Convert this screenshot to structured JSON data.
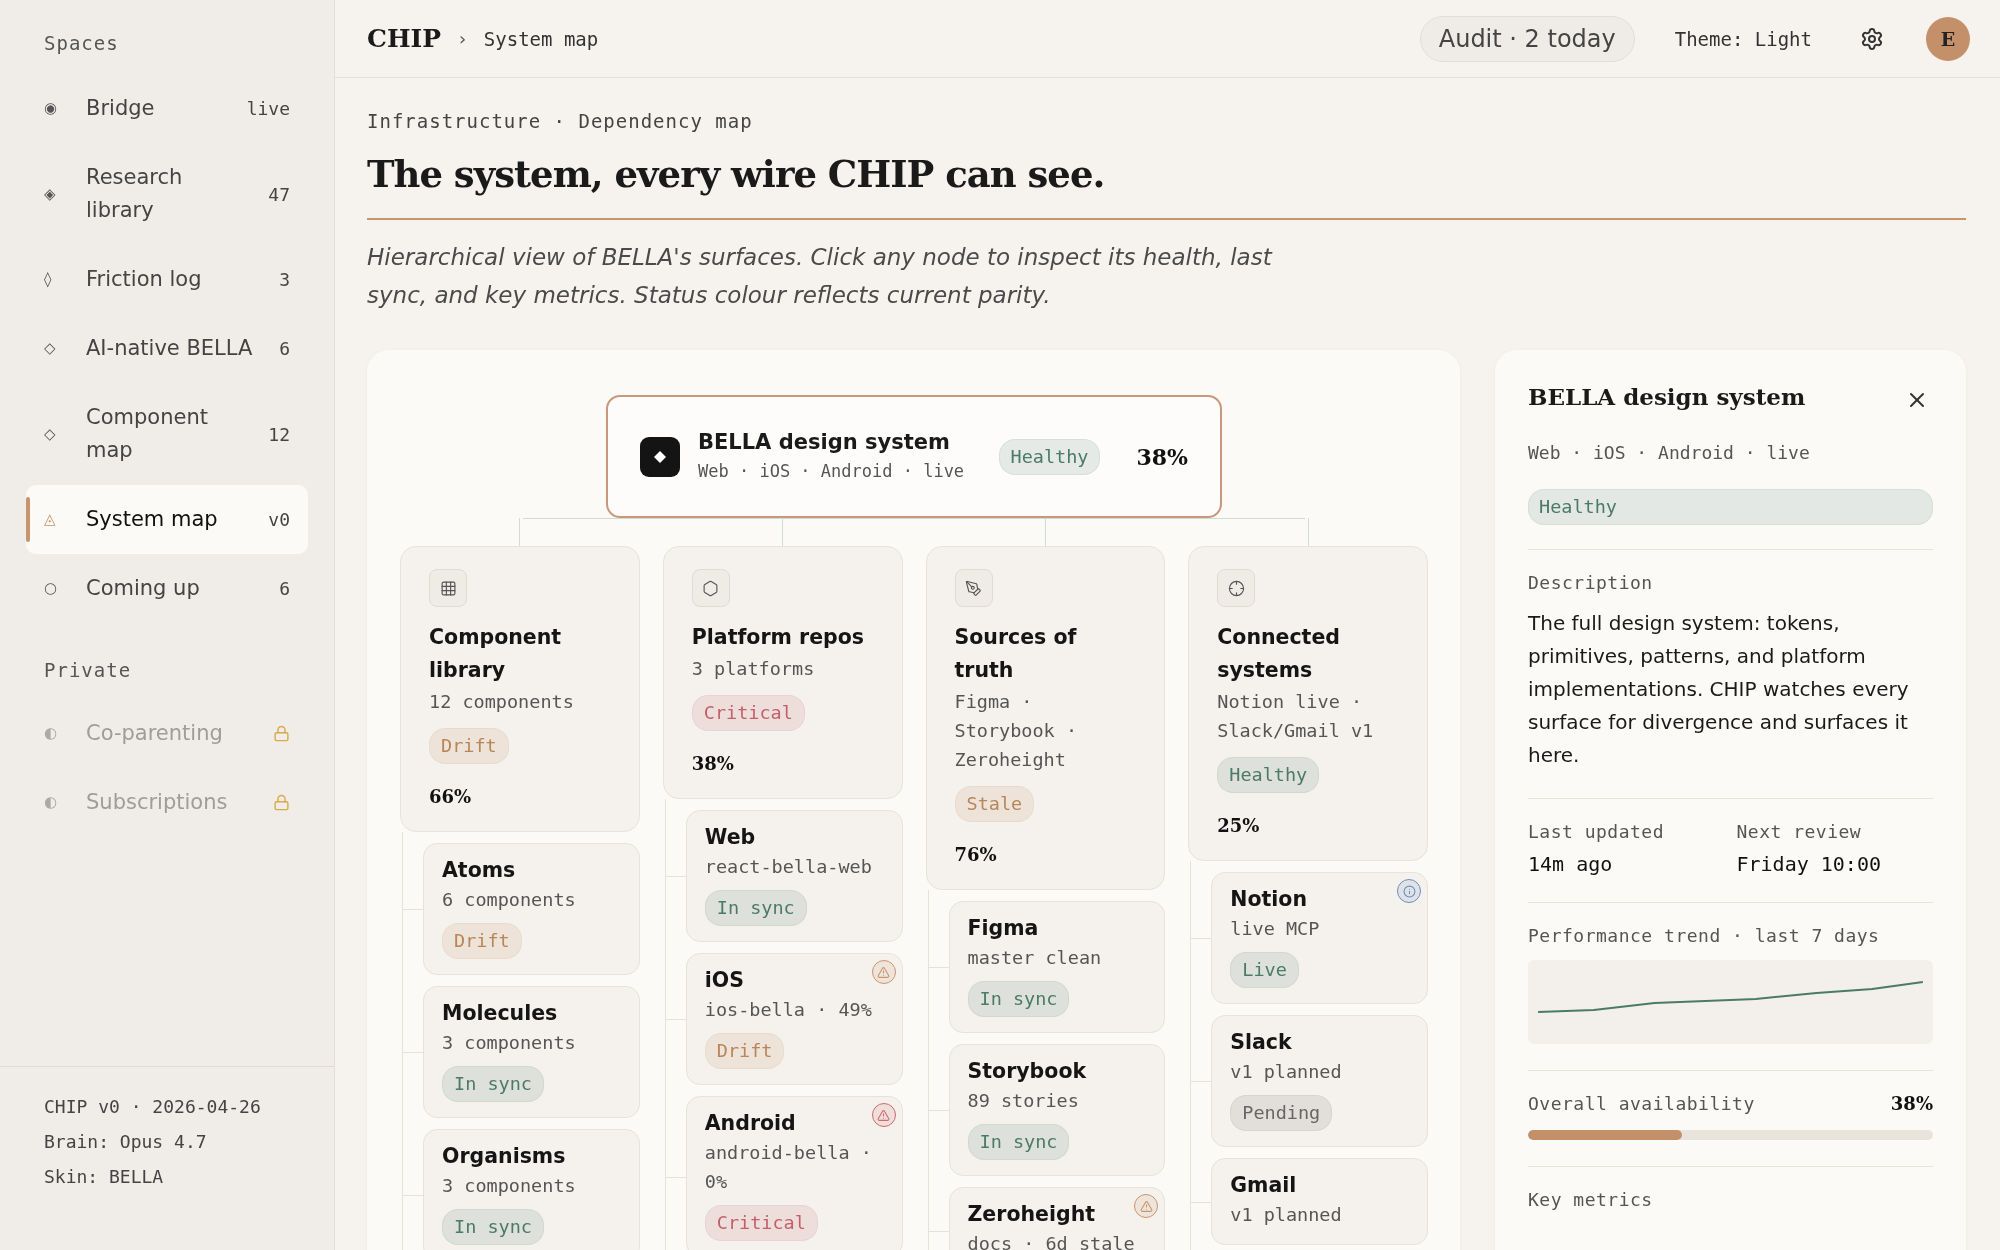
{
  "sidebar": {
    "sections": [
      {
        "heading": "Spaces",
        "items": [
          {
            "icon": "◉",
            "label": "Bridge",
            "count": "live",
            "selected": false,
            "locked": false
          },
          {
            "icon": "◈",
            "label": "Research library",
            "count": "47",
            "selected": false,
            "locked": false
          },
          {
            "icon": "◊",
            "label": "Friction log",
            "count": "3",
            "selected": false,
            "locked": false
          },
          {
            "icon": "◇",
            "label": "AI-native BELLA",
            "count": "6",
            "selected": false,
            "locked": false
          },
          {
            "icon": "◇",
            "label": "Component map",
            "count": "12",
            "selected": false,
            "locked": false
          },
          {
            "icon": "◬",
            "label": "System map",
            "count": "v0",
            "selected": true,
            "locked": false
          },
          {
            "icon": "○",
            "label": "Coming up",
            "count": "6",
            "selected": false,
            "locked": false
          }
        ]
      },
      {
        "heading": "Private",
        "items": [
          {
            "icon": "◐",
            "label": "Co-parenting",
            "selected": false,
            "locked": true
          },
          {
            "icon": "◐",
            "label": "Subscriptions",
            "selected": false,
            "locked": true
          }
        ]
      }
    ],
    "footer": [
      "CHIP v0 · 2026-04-26",
      "Brain: Opus 4.7",
      "Skin: BELLA"
    ]
  },
  "topbar": {
    "brand": "CHIP",
    "separator": "›",
    "crumb": "System map",
    "audit": "Audit · 2 today",
    "theme": "Theme: Light",
    "avatar": "E"
  },
  "header": {
    "eyebrow": "Infrastructure · Dependency map",
    "title": "The system, every wire CHIP can see.",
    "intro": "Hierarchical view of BELLA's surfaces. Click any node to inspect its health, last sync, and key metrics. Status colour reflects current parity."
  },
  "map": {
    "root": {
      "title": "BELLA design system",
      "meta": "Web · iOS · Android · live",
      "status": {
        "label": "Healthy",
        "color": "#4b7a68"
      },
      "percent": "38%",
      "selected": true
    },
    "groups": [
      {
        "title": "Component library",
        "meta": "12 components",
        "status": {
          "label": "Drift",
          "color": "#b88658"
        },
        "percent": "66%",
        "selected": false,
        "children": [
          {
            "title": "Atoms",
            "meta": "6 components",
            "status": {
              "label": "Drift",
              "color": "#b88658"
            },
            "selected": false
          },
          {
            "title": "Molecules",
            "meta": "3 components",
            "status": {
              "label": "In sync",
              "color": "#4b7a68"
            },
            "selected": false
          },
          {
            "title": "Organisms",
            "meta": "3 components",
            "status": {
              "label": "In sync",
              "color": "#4b7a68"
            },
            "selected": false
          }
        ]
      },
      {
        "title": "Platform repos",
        "meta": "3 platforms",
        "status": {
          "label": "Critical",
          "color": "#c2606a"
        },
        "percent": "38%",
        "selected": false,
        "children": [
          {
            "title": "Web",
            "meta": "react-bella-web",
            "status": {
              "label": "In sync",
              "color": "#4b7a68"
            },
            "selected": false
          },
          {
            "title": "iOS",
            "meta": "ios-bella · 49%",
            "status": {
              "label": "Drift",
              "color": "#b88658"
            },
            "alert": {
              "kind": "warning",
              "color": "#c99670"
            },
            "selected": false
          },
          {
            "title": "Android",
            "meta": "android-bella · 0%",
            "status": {
              "label": "Critical",
              "color": "#c2606a"
            },
            "alert": {
              "kind": "warning",
              "color": "#d06a70"
            },
            "selected": false
          }
        ]
      },
      {
        "title": "Sources of truth",
        "meta": "Figma · Storybook · Zeroheight",
        "status": {
          "label": "Stale",
          "color": "#b88658"
        },
        "percent": "76%",
        "selected": false,
        "children": [
          {
            "title": "Figma",
            "meta": "master clean",
            "status": {
              "label": "In sync",
              "color": "#4b7a68"
            },
            "selected": false
          },
          {
            "title": "Storybook",
            "meta": "89 stories",
            "status": {
              "label": "In sync",
              "color": "#4b7a68"
            },
            "selected": false
          },
          {
            "title": "Zeroheight",
            "meta": "docs · 6d stale",
            "alert": {
              "kind": "warning",
              "color": "#c99670"
            },
            "selected": false
          }
        ]
      },
      {
        "title": "Connected systems",
        "meta": "Notion live · Slack/Gmail v1",
        "status": {
          "label": "Healthy",
          "color": "#4b7a68"
        },
        "percent": "25%",
        "selected": false,
        "children": [
          {
            "title": "Notion",
            "meta": "live MCP",
            "status": {
              "label": "Live",
              "color": "#4b7a68"
            },
            "alert": {
              "kind": "info",
              "color": "#6a8ec4"
            },
            "selected": false
          },
          {
            "title": "Slack",
            "meta": "v1 planned",
            "status": {
              "label": "Pending",
              "color": "#666666"
            },
            "selected": false
          },
          {
            "title": "Gmail",
            "meta": "v1 planned",
            "selected": false
          }
        ]
      }
    ]
  },
  "detail": {
    "title": "BELLA design system",
    "meta": "Web · iOS · Android · live",
    "status": {
      "label": "Healthy",
      "color": "#4b7a68"
    },
    "description_label": "Description",
    "description": "The full design system: tokens, primitives, patterns, and platform implementations. CHIP watches every surface for divergence and surfaces it here.",
    "facts": [
      {
        "label": "Last updated",
        "value": "14m ago"
      },
      {
        "label": "Next review",
        "value": "Friday 10:00"
      }
    ],
    "trend_label": "Performance trend · last 7 days",
    "availability": {
      "label": "Overall availability",
      "reading": "38%",
      "level": 0.38
    },
    "metrics_label": "Key metrics"
  }
}
